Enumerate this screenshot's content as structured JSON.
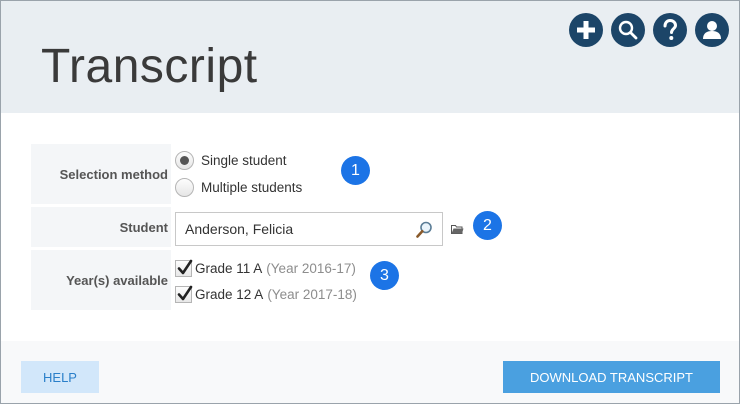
{
  "header": {
    "title": "Transcript",
    "icons": [
      "add-icon",
      "search-icon",
      "help-icon",
      "user-icon"
    ]
  },
  "form": {
    "selection_method": {
      "label": "Selection method",
      "options": [
        {
          "label": "Single student",
          "selected": true
        },
        {
          "label": "Multiple students",
          "selected": false
        }
      ]
    },
    "student": {
      "label": "Student",
      "value": "Anderson, Felicia"
    },
    "years": {
      "label": "Year(s) available",
      "items": [
        {
          "grade": "Grade 11 A",
          "year": "(Year 2016-17)",
          "checked": true
        },
        {
          "grade": "Grade 12 A",
          "year": "(Year 2017-18)",
          "checked": true
        }
      ]
    }
  },
  "markers": [
    "1",
    "2",
    "3"
  ],
  "footer": {
    "help_label": "HELP",
    "download_label": "DOWNLOAD TRANSCRIPT"
  },
  "colors": {
    "header_bg": "#e9eef2",
    "icon_btn": "#1c4568",
    "marker": "#1c74e6",
    "primary_btn": "#4aa0e0",
    "secondary_btn": "#d2e7fa"
  }
}
